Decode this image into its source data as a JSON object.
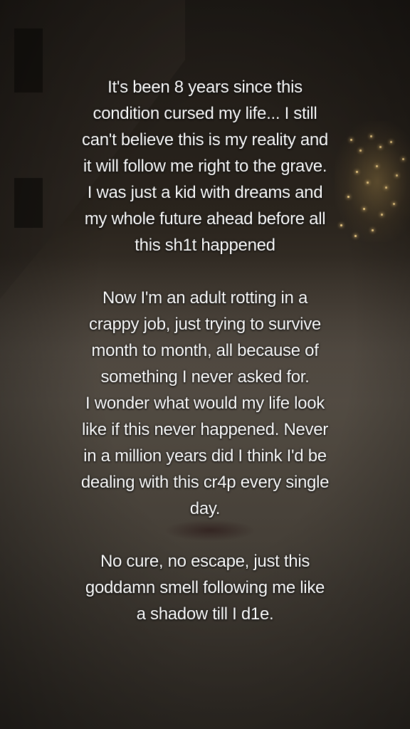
{
  "caption": {
    "paragraphs": [
      {
        "lines": [
          "It's been 8 years since this",
          "condition cursed my life... I still",
          "can't believe this is my reality and",
          "it will follow me right to the grave.",
          "I was just a kid with dreams and",
          "my whole future ahead before all",
          "this sh1t happened"
        ]
      },
      {
        "lines": [
          "Now I'm an adult rotting in a",
          "crappy job, just trying to survive",
          "month to month, all because of",
          "something I never asked for.",
          "I wonder what would my life look",
          "like if this never happened. Never",
          "in a million years did I think I'd be",
          "dealing with this cr4p every single",
          "day."
        ]
      },
      {
        "lines": [
          "No cure, no escape, just this",
          "goddamn smell following me like",
          "a shadow till I d1e."
        ]
      }
    ]
  },
  "colors": {
    "text": "#ffffff",
    "city_lights": "#f2d08a"
  }
}
